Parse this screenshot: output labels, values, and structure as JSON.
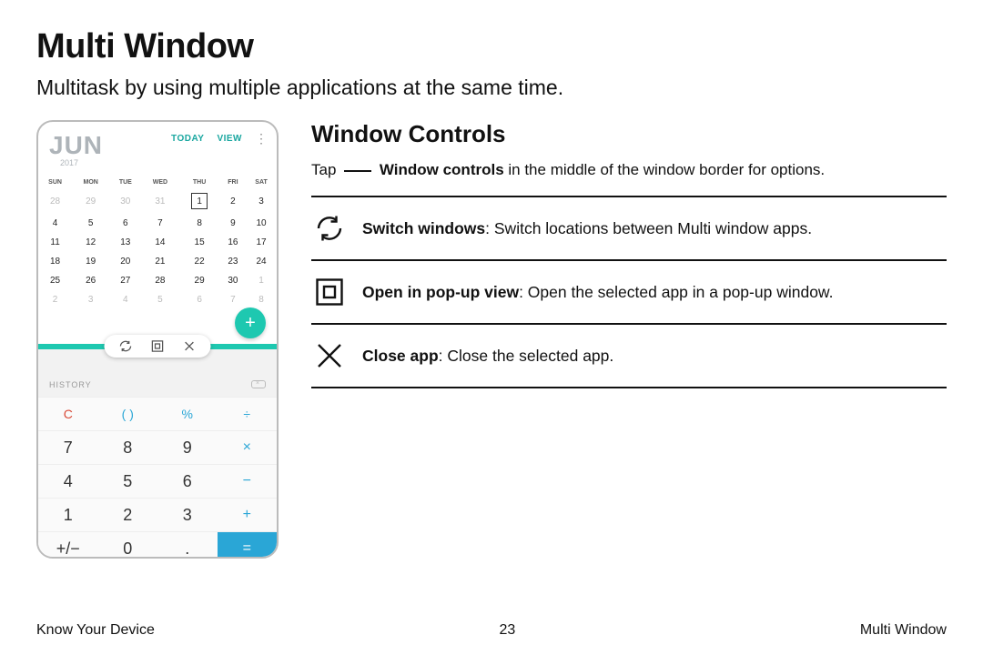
{
  "title": "Multi Window",
  "subtitle": "Multitask by using multiple applications at the same time.",
  "section_heading": "Window Controls",
  "tap_line": {
    "prefix": "Tap ",
    "bold": "Window controls",
    "suffix": " in the middle of the window border for options."
  },
  "controls": [
    {
      "bold": "Switch windows",
      "desc": ": Switch locations between Multi window apps."
    },
    {
      "bold": "Open in pop-up view",
      "desc": ": Open the selected app in a pop-up window."
    },
    {
      "bold": "Close app",
      "desc": ": Close the selected app."
    }
  ],
  "phone": {
    "calendar": {
      "month": "JUN",
      "year": "2017",
      "today": "TODAY",
      "view": "VIEW",
      "weekdays": [
        "SUN",
        "MON",
        "TUE",
        "WED",
        "THU",
        "FRI",
        "SAT"
      ],
      "rows": [
        {
          "cells": [
            "28",
            "29",
            "30",
            "31",
            "1",
            "2",
            "3"
          ],
          "dim": [
            0,
            1,
            2,
            3
          ],
          "selected": 4
        },
        {
          "cells": [
            "4",
            "5",
            "6",
            "7",
            "8",
            "9",
            "10"
          ]
        },
        {
          "cells": [
            "11",
            "12",
            "13",
            "14",
            "15",
            "16",
            "17"
          ]
        },
        {
          "cells": [
            "18",
            "19",
            "20",
            "21",
            "22",
            "23",
            "24"
          ]
        },
        {
          "cells": [
            "25",
            "26",
            "27",
            "28",
            "29",
            "30",
            "1"
          ],
          "dim": [
            6
          ]
        },
        {
          "cells": [
            "2",
            "3",
            "4",
            "5",
            "6",
            "7",
            "8"
          ],
          "dim": [
            0,
            1,
            2,
            3,
            4,
            5,
            6
          ]
        }
      ],
      "fab": "+"
    },
    "calculator": {
      "history": "HISTORY",
      "rows": [
        [
          "C",
          "( )",
          "%",
          "÷"
        ],
        [
          "7",
          "8",
          "9",
          "×"
        ],
        [
          "4",
          "5",
          "6",
          "−"
        ],
        [
          "1",
          "2",
          "3",
          "+"
        ],
        [
          "+/−",
          "0",
          ".",
          "="
        ]
      ]
    }
  },
  "footer": {
    "left": "Know Your Device",
    "center": "23",
    "right": "Multi Window"
  }
}
